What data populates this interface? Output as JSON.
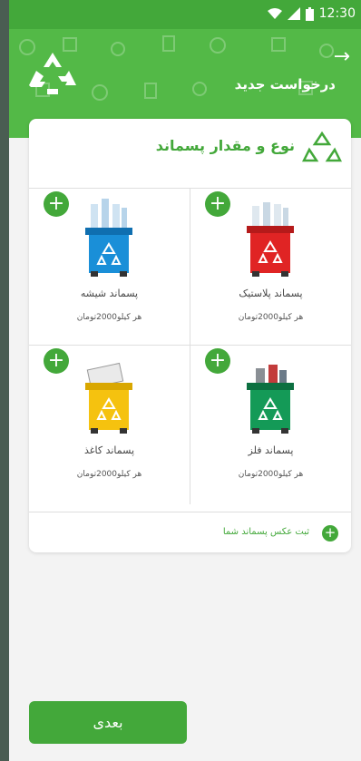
{
  "status_bar": {
    "time": "12:30"
  },
  "header": {
    "title": "درخواست جدید"
  },
  "card": {
    "title": "نوع و مقدار پسماند",
    "items": [
      {
        "name": "پسماند پلاستیک",
        "price": "هر کیلو2000تومان",
        "bin_color": "#e02424",
        "icon": "plastic-bin-icon"
      },
      {
        "name": "پسماند شیشه",
        "price": "هر کیلو2000تومان",
        "bin_color": "#1a8fd8",
        "icon": "glass-bin-icon"
      },
      {
        "name": "پسماند فلز",
        "price": "هر کیلو2000تومان",
        "bin_color": "#149a57",
        "icon": "metal-bin-icon"
      },
      {
        "name": "پسماند کاغذ",
        "price": "هر کیلو2000تومان",
        "bin_color": "#f5c20f",
        "icon": "paper-bin-icon"
      }
    ],
    "photo_label": "ثبت عکس پسماند شما"
  },
  "next_button": "بعدی",
  "colors": {
    "accent": "#43a83a"
  }
}
